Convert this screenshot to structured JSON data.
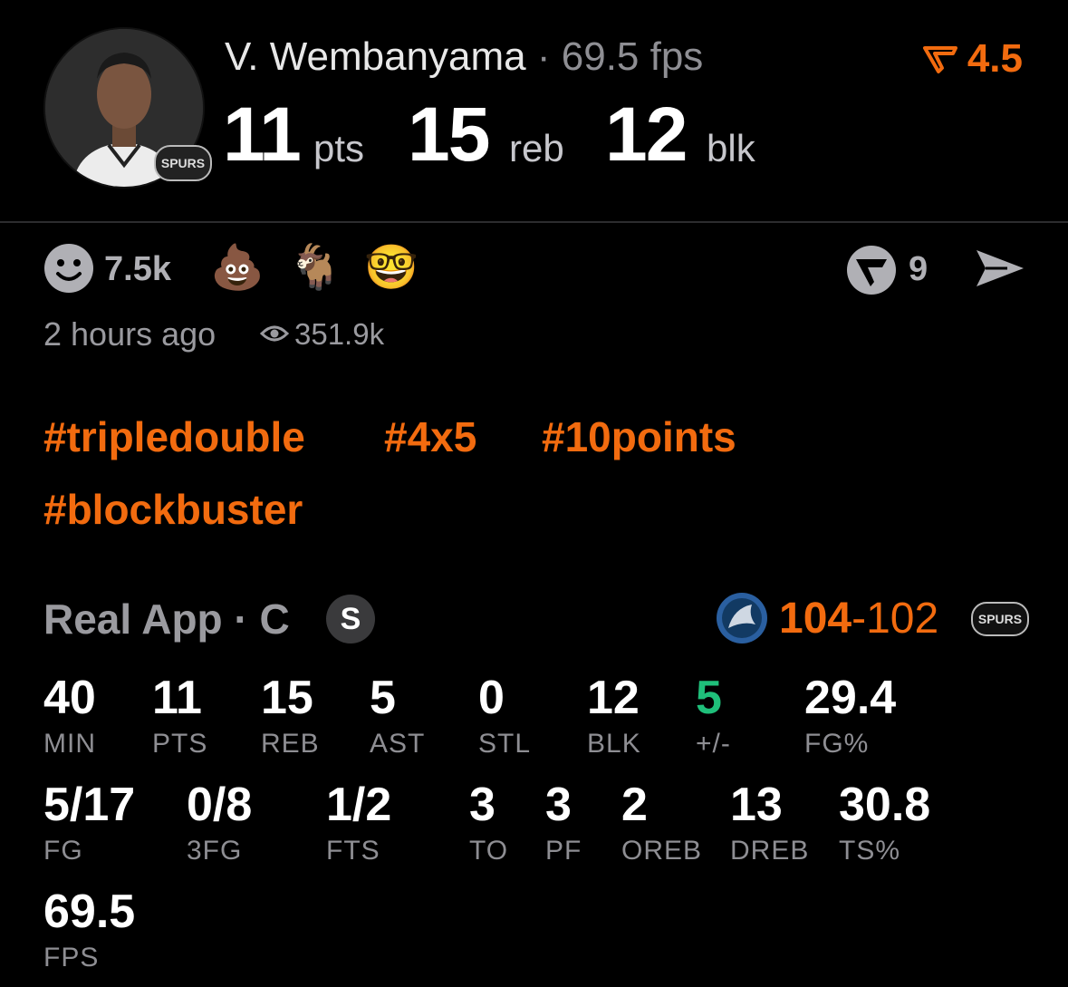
{
  "header": {
    "player_name": "V. Wembanyama",
    "separator": "·",
    "fps_text": "69.5 fps",
    "rating": "4.5",
    "stats": [
      {
        "value": "11",
        "unit": "pts"
      },
      {
        "value": "15",
        "unit": "reb"
      },
      {
        "value": "12",
        "unit": "blk"
      }
    ],
    "team_logo_text": "SPURS"
  },
  "reactions": {
    "count": "7.5k",
    "emojis": [
      "💩",
      "🐐",
      "🤓"
    ],
    "comment_count": "9",
    "time_ago": "2 hours ago",
    "views": "351.9k"
  },
  "hashtags": [
    "#tripledouble",
    "#4x5",
    "#10points",
    "#blockbuster"
  ],
  "game": {
    "app_line": "Real App · C",
    "badge": "S",
    "score_winner": "104",
    "score_dash": "-",
    "score_loser": "102",
    "home_logo_text": "SPURS"
  },
  "box": [
    {
      "value": "40",
      "label": "MIN"
    },
    {
      "value": "11",
      "label": "PTS"
    },
    {
      "value": "15",
      "label": "REB"
    },
    {
      "value": "5",
      "label": "AST"
    },
    {
      "value": "0",
      "label": "STL"
    },
    {
      "value": "12",
      "label": "BLK"
    },
    {
      "value": "5",
      "label": "+/-"
    },
    {
      "value": "29.4",
      "label": "FG%"
    },
    {
      "value": "5/17",
      "label": "FG"
    },
    {
      "value": "0/8",
      "label": "3FG"
    },
    {
      "value": "1/2",
      "label": "FTS"
    },
    {
      "value": "3",
      "label": "TO"
    },
    {
      "value": "3",
      "label": "PF"
    },
    {
      "value": "2",
      "label": "OREB"
    },
    {
      "value": "13",
      "label": "DREB"
    },
    {
      "value": "30.8",
      "label": "TS%"
    },
    {
      "value": "69.5",
      "label": "FPS"
    }
  ],
  "colors": {
    "accent": "#f26b0f",
    "positive": "#1fbf7a"
  }
}
